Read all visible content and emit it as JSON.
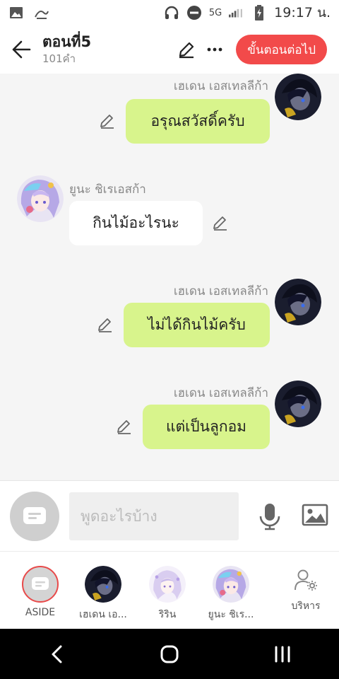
{
  "status": {
    "time": "19:17 น.",
    "network": "5G"
  },
  "header": {
    "title": "ตอนที่5",
    "word_count": "101คำ",
    "next_label": "ขั้นตอนต่อไป"
  },
  "messages": [
    {
      "sender": "เฮเดน เอสเทลลีก้า",
      "text": "อรุณสวัสดิ์ครับ"
    },
    {
      "sender": "ยูนะ ชิเรเอสก้า",
      "text": "กินไม้อะไรนะ"
    },
    {
      "sender": "เฮเดน เอสเทลลีก้า",
      "text": "ไม่ได้กินไม้ครับ"
    },
    {
      "sender": "เฮเดน เอสเทลลีก้า",
      "text": "แต่เป็นลูกอม"
    }
  ],
  "input": {
    "placeholder": "พูดอะไรบ้าง"
  },
  "characters": [
    {
      "label": "ASIDE"
    },
    {
      "label": "เฮเดน เอ..."
    },
    {
      "label": "ริริน"
    },
    {
      "label": "ยูนะ ชิเร..."
    },
    {
      "label": "บริหาร"
    }
  ],
  "colors": {
    "accent": "#f24a4a",
    "bubble_green": "#d8f48c",
    "chat_bg": "#f5f5f5"
  }
}
